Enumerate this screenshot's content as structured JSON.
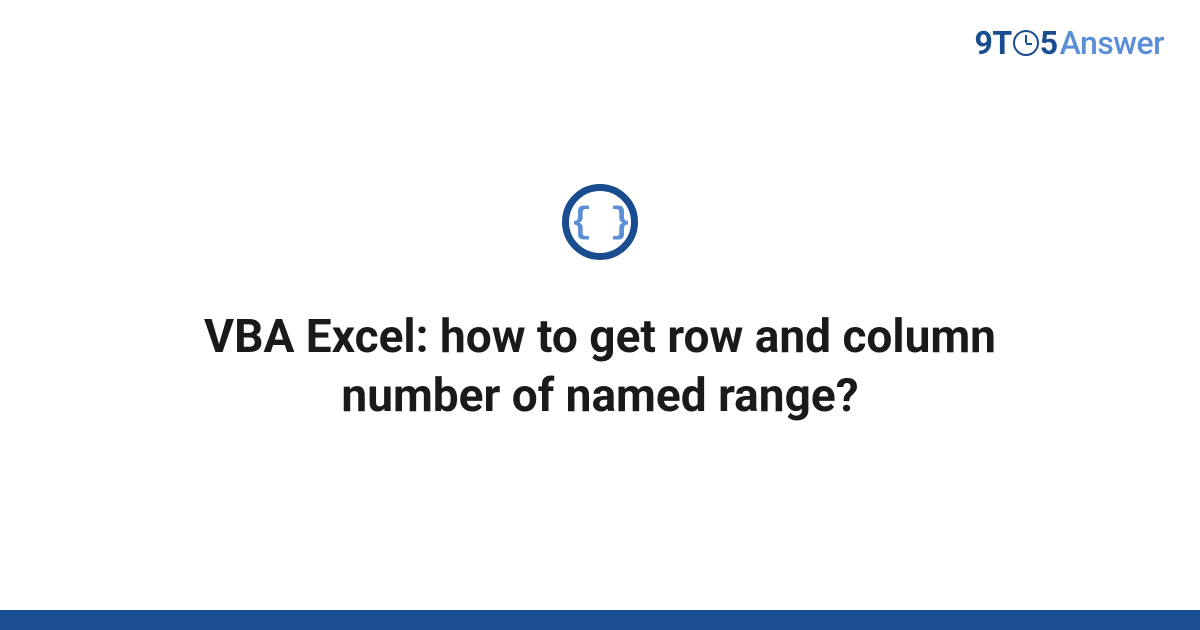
{
  "brand": {
    "part1": "9",
    "part2": "T",
    "part3": "5",
    "part4": "Answer"
  },
  "icon": {
    "content": "{ }",
    "name": "code-braces-icon"
  },
  "question": {
    "title": "VBA Excel: how to get row and column number of named range?"
  },
  "colors": {
    "primary": "#1a4d8f",
    "secondary": "#5a8fd6"
  }
}
